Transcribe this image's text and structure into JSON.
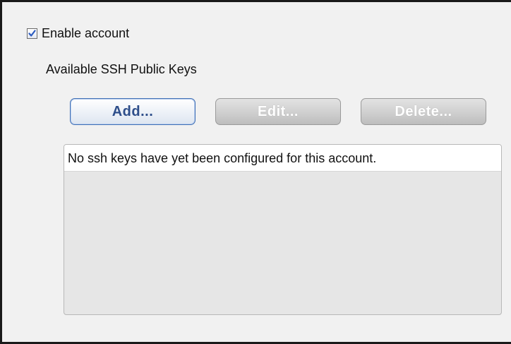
{
  "account": {
    "enable_label": "Enable account",
    "enabled": true
  },
  "ssh_keys": {
    "section_label": "Available SSH Public Keys",
    "buttons": {
      "add_label": "Add...",
      "edit_label": "Edit...",
      "delete_label": "Delete..."
    },
    "empty_message": "No ssh keys have yet been configured for this account."
  },
  "colors": {
    "accent_text": "#2e4e8a",
    "checkmark": "#2b5bbf"
  }
}
